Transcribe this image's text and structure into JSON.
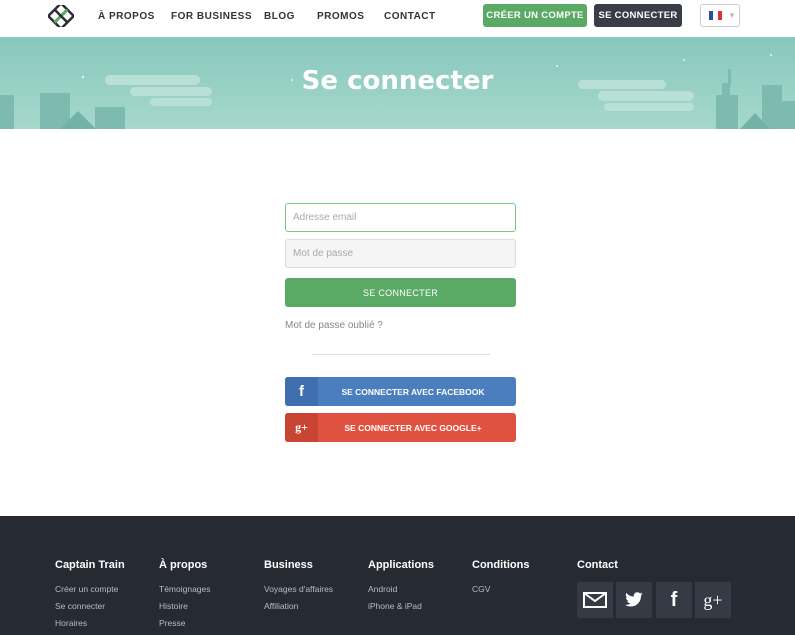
{
  "header": {
    "nav": [
      "À PROPOS",
      "FOR BUSINESS",
      "BLOG",
      "PROMOS",
      "CONTACT"
    ],
    "create_account": "CRÉER UN COMPTE",
    "login": "SE CONNECTER",
    "language": "fr"
  },
  "banner": {
    "title": "Se connecter"
  },
  "form": {
    "email_placeholder": "Adresse email",
    "password_placeholder": "Mot de passe",
    "submit": "SE CONNECTER",
    "forgot": "Mot de passe oublié ?",
    "facebook": "SE CONNECTER AVEC FACEBOOK",
    "google": "SE CONNECTER AVEC GOOGLE+"
  },
  "footer": {
    "columns": [
      {
        "title": "Captain Train",
        "links": [
          "Créer un compte",
          "Se connecter",
          "Horaires"
        ]
      },
      {
        "title": "À propos",
        "links": [
          "Témoignages",
          "Histoire",
          "Presse"
        ]
      },
      {
        "title": "Business",
        "links": [
          "Voyages d'affaires",
          "Affiliation"
        ]
      },
      {
        "title": "Applications",
        "links": [
          "Android",
          "iPhone & iPad"
        ]
      },
      {
        "title": "Conditions",
        "links": [
          "CGV"
        ]
      }
    ],
    "contact_title": "Contact",
    "social_icons": [
      "mail-icon",
      "twitter-icon",
      "facebook-icon",
      "google-plus-icon"
    ]
  },
  "colors": {
    "brand_green": "#5aaa66",
    "dark": "#3a3d47",
    "banner": "#88c7bd",
    "facebook": "#4a7ebf",
    "google": "#e05240",
    "footer": "#262a33"
  }
}
